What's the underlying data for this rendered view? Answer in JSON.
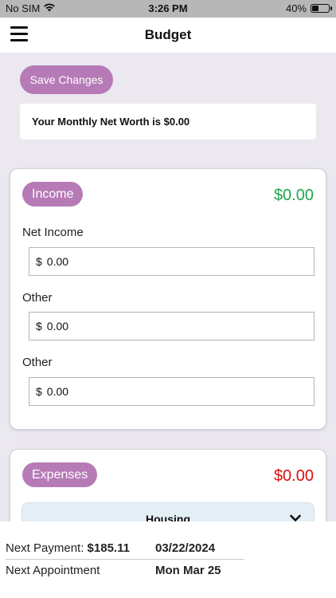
{
  "status_bar": {
    "carrier": "No SIM",
    "time": "3:26 PM",
    "battery": "40%",
    "battery_level": 0.4
  },
  "nav": {
    "title": "Budget"
  },
  "save_label": "Save Changes",
  "net_worth": "Your Monthly Net Worth is $0.00",
  "income": {
    "label": "Income",
    "total": "$0.00",
    "fields": [
      {
        "label": "Net Income",
        "currency": "$",
        "value": "0.00"
      },
      {
        "label": "Other",
        "currency": "$",
        "value": "0.00"
      },
      {
        "label": "Other",
        "currency": "$",
        "value": "0.00"
      }
    ]
  },
  "expenses": {
    "label": "Expenses",
    "total": "$0.00",
    "categories": [
      {
        "label": "Housing"
      }
    ]
  },
  "footer": {
    "payment_label": "Next Payment:",
    "payment_amount": "$185.11",
    "payment_date": "03/22/2024",
    "appointment_label": "Next Appointment",
    "appointment_date": "Mon Mar 25"
  },
  "colors": {
    "accent": "#b67ab7",
    "income_total": "#1fa54c",
    "expense_total": "#d90f0f",
    "background": "#ebe8f0"
  }
}
